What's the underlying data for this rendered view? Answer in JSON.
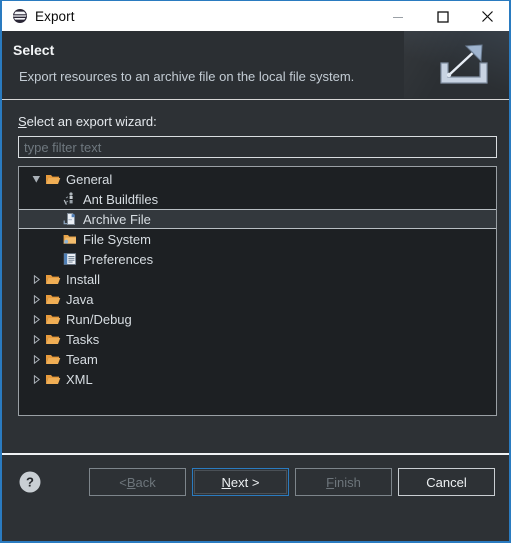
{
  "window": {
    "title": "Export",
    "app_icon": "eclipse-logo-icon",
    "accent_color": "#2a7bc0",
    "controls": [
      {
        "name": "minimize",
        "glyph": "minimize-icon"
      },
      {
        "name": "maximize",
        "glyph": "maximize-icon"
      },
      {
        "name": "close",
        "glyph": "close-icon"
      }
    ]
  },
  "header": {
    "title": "Select",
    "description": "Export resources to an archive file on the local file system.",
    "banner_icon": "export-arrow-icon"
  },
  "main": {
    "field_label_prefix": "S",
    "field_label_rest": "elect an export wizard:",
    "filter": {
      "value": "",
      "placeholder": "type filter text"
    },
    "tree": [
      {
        "label": "General",
        "icon": "folder-open-icon",
        "twisty": "expanded",
        "level": 1,
        "selected": false
      },
      {
        "label": "Ant Buildfiles",
        "icon": "ant-build-icon",
        "twisty": "none",
        "level": 2,
        "selected": false
      },
      {
        "label": "Archive File",
        "icon": "archive-file-icon",
        "twisty": "none",
        "level": 2,
        "selected": true
      },
      {
        "label": "File System",
        "icon": "file-system-icon",
        "twisty": "none",
        "level": 2,
        "selected": false
      },
      {
        "label": "Preferences",
        "icon": "preferences-icon",
        "twisty": "none",
        "level": 2,
        "selected": false
      },
      {
        "label": "Install",
        "icon": "folder-open-icon",
        "twisty": "collapsed",
        "level": 1,
        "selected": false
      },
      {
        "label": "Java",
        "icon": "folder-open-icon",
        "twisty": "collapsed",
        "level": 1,
        "selected": false
      },
      {
        "label": "Run/Debug",
        "icon": "folder-open-icon",
        "twisty": "collapsed",
        "level": 1,
        "selected": false
      },
      {
        "label": "Tasks",
        "icon": "folder-open-icon",
        "twisty": "collapsed",
        "level": 1,
        "selected": false
      },
      {
        "label": "Team",
        "icon": "folder-open-icon",
        "twisty": "collapsed",
        "level": 1,
        "selected": false
      },
      {
        "label": "XML",
        "icon": "folder-open-icon",
        "twisty": "collapsed",
        "level": 1,
        "selected": false
      }
    ]
  },
  "footer": {
    "help_icon": "help-question-icon",
    "back": {
      "prefix": "< ",
      "mnemonic": "B",
      "suffix": "ack",
      "disabled": true,
      "focused": false
    },
    "next": {
      "prefix": "",
      "mnemonic": "N",
      "suffix": "ext >",
      "disabled": false,
      "focused": true
    },
    "finish": {
      "prefix": "",
      "mnemonic": "F",
      "suffix": "inish",
      "disabled": true,
      "focused": false
    },
    "cancel": {
      "prefix": "",
      "mnemonic": "",
      "suffix": "Cancel",
      "disabled": false,
      "focused": false
    }
  }
}
